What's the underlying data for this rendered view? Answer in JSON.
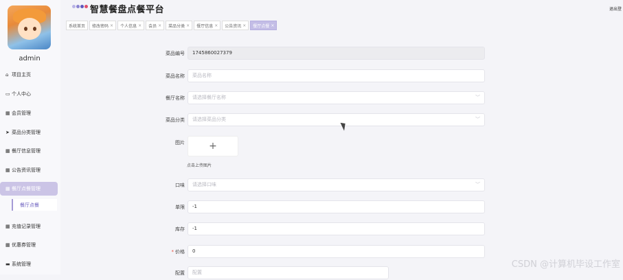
{
  "sidebar": {
    "username": "admin",
    "items": [
      {
        "icon": "⌂",
        "label": "项目主页"
      },
      {
        "icon": "▭",
        "label": "个人中心"
      },
      {
        "icon": "▦",
        "label": "会员管理"
      },
      {
        "icon": "➤",
        "label": "菜品分类管理"
      },
      {
        "icon": "▦",
        "label": "餐厅信息管理"
      },
      {
        "icon": "▦",
        "label": "公告资讯管理"
      },
      {
        "icon": "▦",
        "label": "餐厅点餐管理"
      },
      {
        "icon": "▦",
        "label": "充值记录管理"
      },
      {
        "icon": "▦",
        "label": "优惠券管理"
      },
      {
        "icon": "▬",
        "label": "系统管理"
      }
    ],
    "submenu_item": "餐厅点餐"
  },
  "header": {
    "title": "智慧餐盘点餐平台",
    "logout": "退出登",
    "logo_colors": [
      "#b9b4e6",
      "#8a83d1",
      "#5f57bd",
      "#e04f6c"
    ]
  },
  "tabs": [
    {
      "label": "系统首页",
      "closable": false
    },
    {
      "label": "修改密码",
      "closable": true
    },
    {
      "label": "个人信息",
      "closable": true
    },
    {
      "label": "会员",
      "closable": true
    },
    {
      "label": "菜品分类",
      "closable": true
    },
    {
      "label": "餐厅信息",
      "closable": true
    },
    {
      "label": "公告资讯",
      "closable": true
    },
    {
      "label": "餐厅点餐",
      "closable": true
    }
  ],
  "form": {
    "dish_no": {
      "label": "菜品编号",
      "value": "1745860027379"
    },
    "dish_name": {
      "label": "菜品名称",
      "placeholder": "菜品名称"
    },
    "restaurant": {
      "label": "餐厅名称",
      "placeholder": "请选择餐厅名称"
    },
    "category": {
      "label": "菜品分类",
      "placeholder": "请选择菜品分类"
    },
    "image": {
      "label": "图片",
      "upload_hint": "点击上传图片"
    },
    "taste": {
      "label": "口味",
      "placeholder": "请选择口味"
    },
    "limit": {
      "label": "单限",
      "value": "-1"
    },
    "stock": {
      "label": "库存",
      "value": "-1"
    },
    "price": {
      "label": "价格",
      "value": "0"
    },
    "extra": {
      "label": "配置",
      "placeholder": "配置"
    }
  },
  "watermark": "CSDN @计算机毕设工作室",
  "colors": {
    "accent": "#c3bde6",
    "active_menu": "#cbc4e6"
  }
}
